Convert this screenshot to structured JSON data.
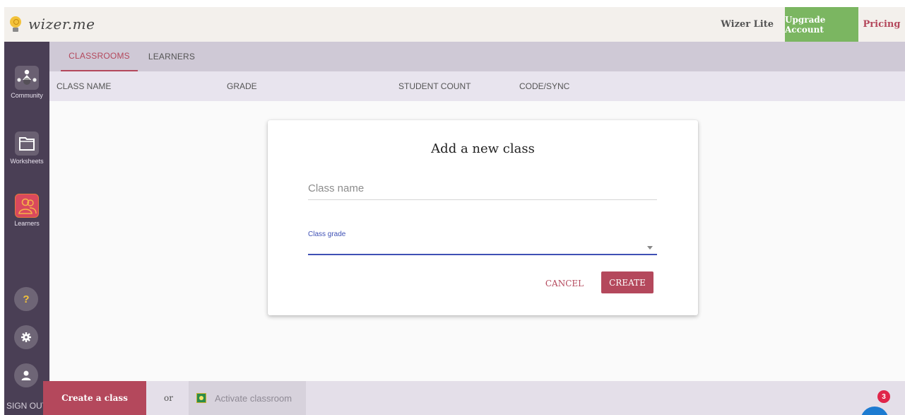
{
  "brand": {
    "name": "wizer.me"
  },
  "header": {
    "plan_label": "Wizer Lite",
    "upgrade_label": "Upgrade Account",
    "pricing_label": "Pricing"
  },
  "sidebar": {
    "items": [
      {
        "label": "Community",
        "icon": "community-icon"
      },
      {
        "label": "Worksheets",
        "icon": "folder-icon"
      },
      {
        "label": "Learners",
        "icon": "learners-icon"
      }
    ],
    "help_glyph": "?",
    "sign_out_label": "SIGN OUT"
  },
  "tabs": [
    {
      "label": "CLASSROOMS",
      "active": true
    },
    {
      "label": "LEARNERS",
      "active": false
    }
  ],
  "table": {
    "columns": [
      "CLASS NAME",
      "GRADE",
      "STUDENT COUNT",
      "CODE/SYNC"
    ]
  },
  "modal": {
    "title": "Add a new class",
    "class_name_placeholder": "Class name",
    "class_grade_label": "Class grade",
    "cancel_label": "CANCEL",
    "create_label": "CREATE"
  },
  "bottom": {
    "create_class_label": "Create a class",
    "or_label": "or",
    "activate_label": "Activate classroom"
  },
  "chat": {
    "badge_count": "3"
  },
  "colors": {
    "accent": "#b4485c",
    "upgrade": "#7bb661",
    "sidebar": "#4a3f55",
    "focus": "#3f51b5"
  }
}
